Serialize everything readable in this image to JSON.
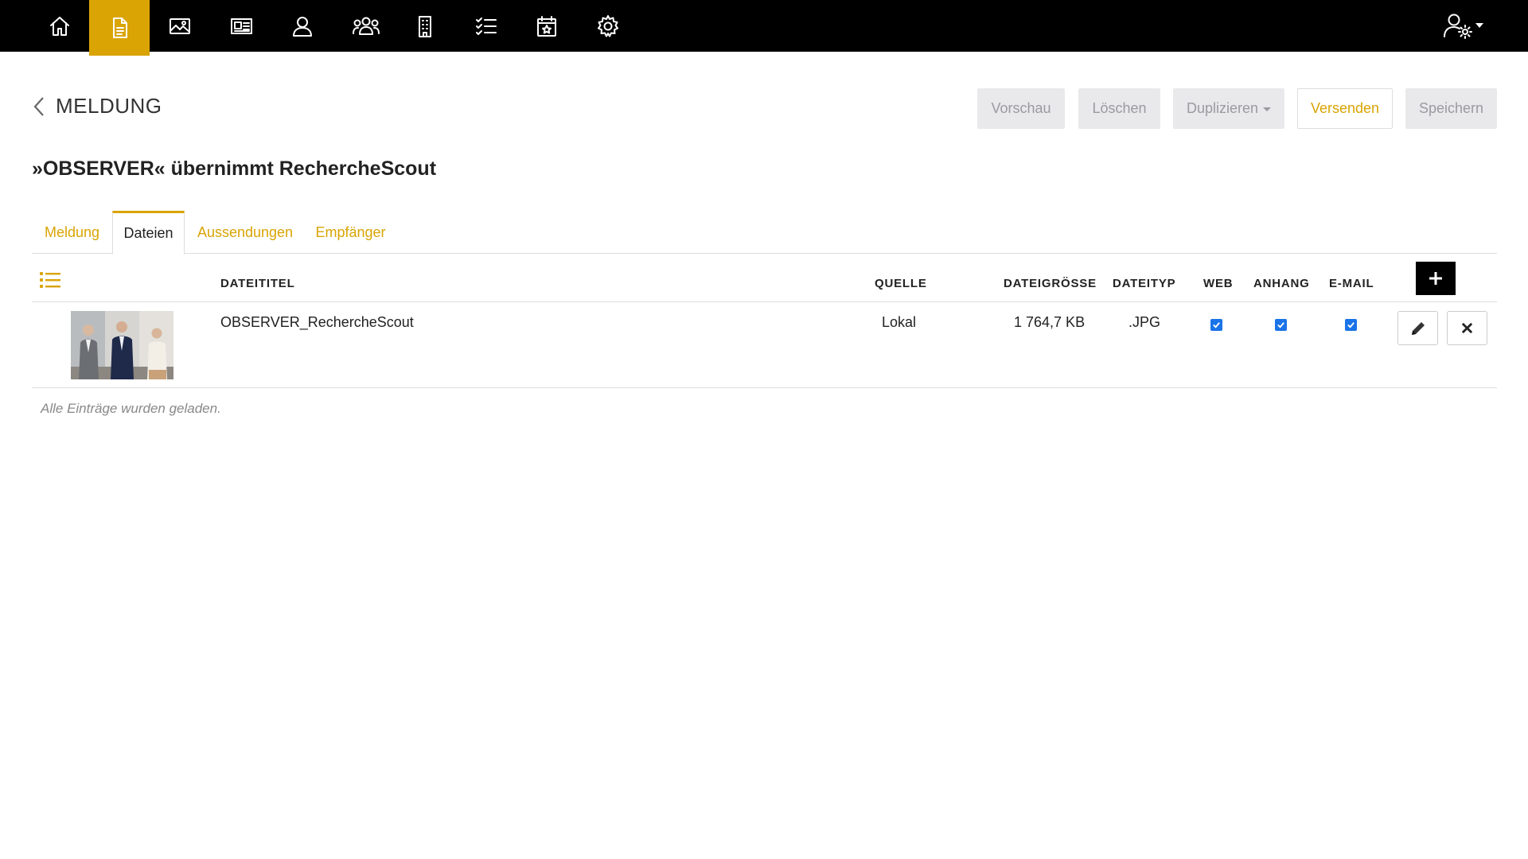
{
  "nav": {
    "items": [
      {
        "icon": "home-icon",
        "label": ""
      },
      {
        "icon": "document-icon",
        "label": "",
        "active": true
      },
      {
        "icon": "image-icon",
        "label": ""
      },
      {
        "icon": "newspaper-icon",
        "label": ""
      },
      {
        "icon": "person-icon",
        "label": ""
      },
      {
        "icon": "group-icon",
        "label": ""
      },
      {
        "icon": "building-icon",
        "label": ""
      },
      {
        "icon": "checklist-icon",
        "label": ""
      },
      {
        "icon": "calendar-star-icon",
        "label": ""
      },
      {
        "icon": "gear-icon",
        "label": ""
      }
    ],
    "user_menu_icon": "user-settings-icon"
  },
  "header": {
    "section": "MELDUNG",
    "title": "»OBSERVER« übernimmt RechercheScout",
    "buttons": {
      "preview": "Vorschau",
      "delete": "Löschen",
      "duplicate": "Duplizieren",
      "send": "Versenden",
      "save": "Speichern"
    }
  },
  "tabs": [
    {
      "label": "Meldung"
    },
    {
      "label": "Dateien",
      "active": true
    },
    {
      "label": "Aussendungen"
    },
    {
      "label": "Empfänger"
    }
  ],
  "table": {
    "columns": {
      "title": "DATEITITEL",
      "source": "QUELLE",
      "size": "DATEIGRÖSSE",
      "type": "DATEITYP",
      "web": "WEB",
      "attachment": "ANHANG",
      "email": "E-MAIL"
    },
    "rows": [
      {
        "title": "OBSERVER_RechercheScout",
        "source": "Lokal",
        "size": "1 764,7 KB",
        "type": ".JPG",
        "web": true,
        "attachment": true,
        "email": true
      }
    ],
    "footer": "Alle Einträge wurden geladen."
  },
  "colors": {
    "accent": "#d9a404",
    "nav_bg": "#000000",
    "checkbox": "#1a73e8"
  }
}
